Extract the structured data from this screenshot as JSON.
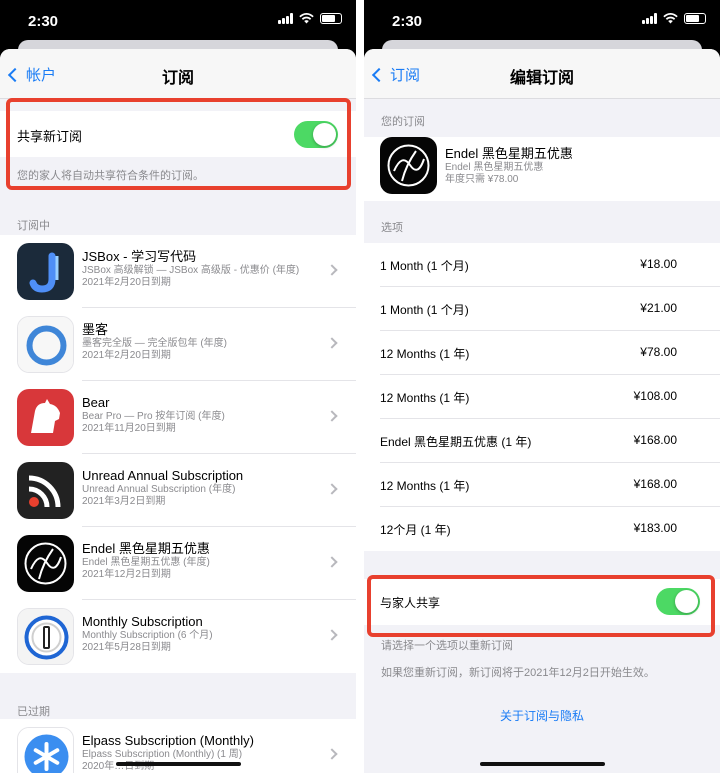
{
  "status": {
    "time": "2:30"
  },
  "left": {
    "nav": {
      "back_label": "帐户",
      "title": "订阅"
    },
    "share": {
      "label": "共享新订阅",
      "note": "您的家人将自动共享符合条件的订阅。"
    },
    "active_header": "订阅中",
    "expired_header": "已过期",
    "subscriptions": [
      {
        "name": "JSBox - 学习写代码",
        "detail": "JSBox 高级解锁 — JSBox 高级版 - 优惠价 (年度)",
        "date": "2021年2月20日到期",
        "icon": "jsbox-icon"
      },
      {
        "name": "墨客",
        "detail": "墨客完全版 — 完全版包年 (年度)",
        "date": "2021年2月20日到期",
        "icon": "moke-icon"
      },
      {
        "name": "Bear",
        "detail": "Bear Pro — Pro 按年订阅 (年度)",
        "date": "2021年11月20日到期",
        "icon": "bear-icon"
      },
      {
        "name": "Unread Annual Subscription",
        "detail": "Unread Annual Subscription (年度)",
        "date": "2021年3月2日到期",
        "icon": "rss-icon"
      },
      {
        "name": "Endel 黑色星期五优惠",
        "detail": "Endel 黑色星期五优惠 (年度)",
        "date": "2021年12月2日到期",
        "icon": "endel-icon"
      },
      {
        "name": "Monthly Subscription",
        "detail": "Monthly Subscription (6 个月)",
        "date": "2021年5月28日到期",
        "icon": "onepassword-icon"
      }
    ],
    "expired": [
      {
        "name": "Elpass Subscription (Monthly)",
        "detail": "Elpass Subscription (Monthly) (1 周)",
        "date": "2020年…日到期",
        "icon": "elpass-icon"
      }
    ]
  },
  "right": {
    "nav": {
      "back_label": "订阅",
      "title": "编辑订阅"
    },
    "yours_header": "您的订阅",
    "current": {
      "name": "Endel 黑色星期五优惠",
      "sub": "Endel 黑色星期五优惠",
      "price": "年度只需 ¥78.00"
    },
    "options_header": "选项",
    "options": [
      {
        "label": "1 Month (1 个月)",
        "price": "¥18.00"
      },
      {
        "label": "1 Month (1 个月)",
        "price": "¥21.00"
      },
      {
        "label": "12 Months (1 年)",
        "price": "¥78.00"
      },
      {
        "label": "12 Months (1 年)",
        "price": "¥108.00"
      },
      {
        "label": "Endel 黑色星期五优惠 (1 年)",
        "price": "¥168.00"
      },
      {
        "label": "12 Months (1 年)",
        "price": "¥168.00"
      },
      {
        "label": "12个月 (1 年)",
        "price": "¥183.00"
      }
    ],
    "family": {
      "label": "与家人共享",
      "note1": "请选择一个选项以重新订阅",
      "note2": "如果您重新订阅，新订阅将于2021年12月2日开始生效。"
    },
    "privacy_link": "关于订阅与隐私"
  },
  "colors": {
    "accent": "#1a7cf5",
    "toggle_on": "#4cd964",
    "highlight": "#e8402e"
  }
}
